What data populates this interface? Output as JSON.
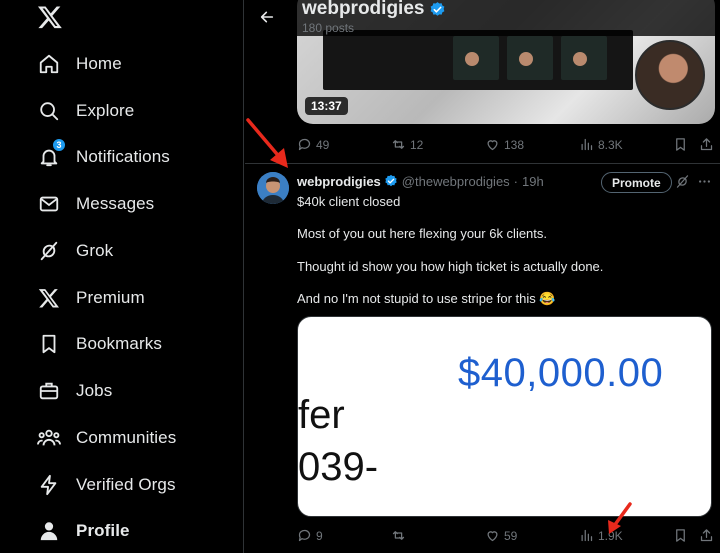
{
  "sidebar": {
    "items": [
      {
        "label": "Home"
      },
      {
        "label": "Explore"
      },
      {
        "label": "Notifications",
        "badge": "3"
      },
      {
        "label": "Messages"
      },
      {
        "label": "Grok"
      },
      {
        "label": "Premium"
      },
      {
        "label": "Bookmarks"
      },
      {
        "label": "Jobs"
      },
      {
        "label": "Communities"
      },
      {
        "label": "Verified Orgs"
      },
      {
        "label": "Profile"
      }
    ]
  },
  "header": {
    "name": "webprodigies",
    "posts": "180 posts"
  },
  "video_post": {
    "duration": "13:37",
    "stats": {
      "replies": "49",
      "reposts": "12",
      "likes": "138",
      "views": "8.3K"
    }
  },
  "post": {
    "name": "webprodigies",
    "handle": "@thewebprodigies",
    "sep": "·",
    "time": "19h",
    "promote_label": "Promote",
    "lines": [
      "$40k client closed",
      "Most of you out here flexing your 6k clients.",
      "Thought id show you how high ticket is actually done.",
      "And no I'm not stupid to use stripe for this 😂"
    ],
    "image_text": {
      "amount": "$40,000.00",
      "line1": "fer",
      "line2": "039-"
    },
    "stats": {
      "replies": "9",
      "reposts": "",
      "likes": "59",
      "views": "1.9K"
    }
  },
  "colors": {
    "accent": "#1d9bf0",
    "annotation": "#e8291c",
    "amount": "#1e5fcf"
  }
}
